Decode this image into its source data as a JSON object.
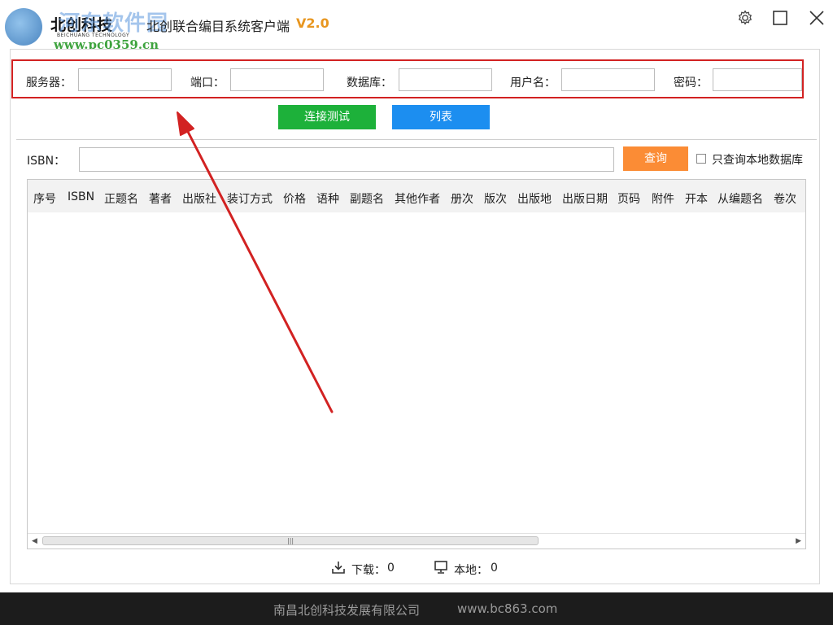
{
  "window": {
    "brand": "北创科技",
    "brand_sub": "BEICHUANG TECHNOLOGY",
    "watermark": "河东软件园",
    "watermark_url": "www.pc0359.cn",
    "title": "北创联合编目系统客户端",
    "version": "V2.0",
    "controls": [
      "gear-icon",
      "maximize-icon",
      "close-icon"
    ]
  },
  "connection": {
    "server_label": "服务器：",
    "port_label": "端口：",
    "database_label": "数据库：",
    "username_label": "用户名：",
    "password_label": "密码：",
    "server_value": "",
    "port_value": "",
    "database_value": "",
    "username_value": "",
    "password_value": ""
  },
  "actions": {
    "test_label": "连接测试",
    "list_label": "列表"
  },
  "search": {
    "isbn_label": "ISBN：",
    "isbn_value": "",
    "query_label": "查询",
    "local_only_label": "只查询本地数据库",
    "local_only_checked": false
  },
  "grid": {
    "columns": [
      "序号",
      "ISBN",
      "正题名",
      "著者",
      "出版社",
      "装订方式",
      "价格",
      "语种",
      "副题名",
      "其他作者",
      "册次",
      "版次",
      "出版地",
      "出版日期",
      "页码",
      "附件",
      "开本",
      "从编题名",
      "卷次"
    ],
    "rows": []
  },
  "status": {
    "download_label": "下载：",
    "download_count": "0",
    "local_label": "本地：",
    "local_count": "0"
  },
  "footer": {
    "company": "南昌北创科技发展有限公司",
    "website": "www.bc863.com"
  },
  "colors": {
    "test_button": "#1db13a",
    "list_button": "#1c8ef0",
    "query_button": "#fb8c35",
    "highlight_frame": "#d22222",
    "version": "#e8961f",
    "footer_bg": "#1c1c1c"
  }
}
